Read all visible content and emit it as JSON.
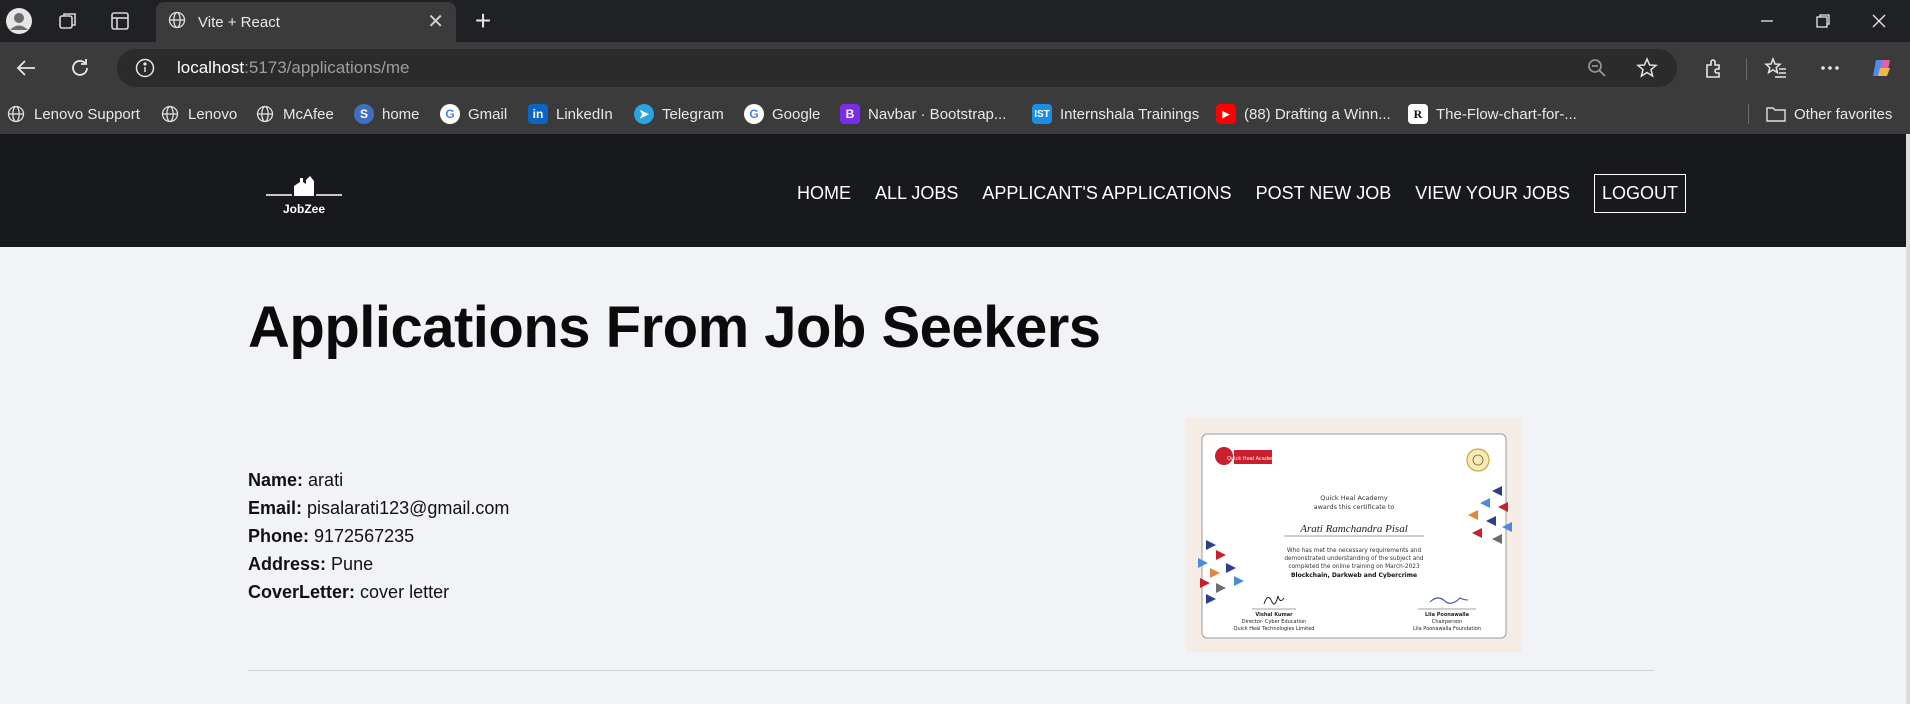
{
  "browser": {
    "tab_title": "Vite + React",
    "url_host": "localhost",
    "url_path": ":5173/applications/me",
    "bookmarks": [
      {
        "label": "Lenovo Support",
        "icon": "globe-icon"
      },
      {
        "label": "Lenovo",
        "icon": "globe-icon"
      },
      {
        "label": "McAfee",
        "icon": "globe-icon"
      },
      {
        "label": "home",
        "icon": "s-logo-icon"
      },
      {
        "label": "Gmail",
        "icon": "google-icon"
      },
      {
        "label": "LinkedIn",
        "icon": "linkedin-icon"
      },
      {
        "label": "Telegram",
        "icon": "telegram-icon"
      },
      {
        "label": "Google",
        "icon": "google-icon"
      },
      {
        "label": "Navbar · Bootstrap...",
        "icon": "bootstrap-icon"
      },
      {
        "label": "Internshala Trainings",
        "icon": "internshala-icon"
      },
      {
        "label": "(88) Drafting a Winn...",
        "icon": "youtube-icon"
      },
      {
        "label": "The-Flow-chart-for-...",
        "icon": "r-logo-icon"
      }
    ],
    "other_favorites": "Other favorites"
  },
  "site": {
    "logo_text": "JobZee",
    "nav": [
      "HOME",
      "ALL JOBS",
      "APPLICANT'S APPLICATIONS",
      "POST NEW JOB",
      "VIEW YOUR JOBS"
    ],
    "logout": "LOGOUT"
  },
  "main": {
    "title": "Applications From Job Seekers"
  },
  "application": {
    "name_label": "Name:",
    "name": "arati",
    "email_label": "Email:",
    "email": "pisalarati123@gmail.com",
    "phone_label": "Phone:",
    "phone": "9172567235",
    "address_label": "Address:",
    "address": "Pune",
    "cover_label": "CoverLetter:",
    "cover": "cover letter"
  },
  "certificate": {
    "org_badge": "Quick Heal Academy",
    "awards_line1": "Quick Heal Academy",
    "awards_line2": "awards this certificate to",
    "recipient": "Arati Ramchandra Pisal",
    "body_line1": "Who has met the necessary requirements and",
    "body_line2": "demonstrated understanding of the subject and",
    "body_line3": "completed the online training on March-2023",
    "course": "Blockchain, Darkweb and Cybercrime",
    "signer1_name": "Vishal Kumar",
    "signer1_title": "Director- Cyber Education",
    "signer1_org": "Quick Heal Technologies Limited",
    "signer2_name": "Lila Poonawalla",
    "signer2_title": "Chairperson",
    "signer2_org": "Lila Poonawalla Foundation"
  },
  "colors": {
    "nav_bg": "#18191c",
    "page_bg": "#f1f3f6",
    "chrome_bg": "#3b3b3b"
  }
}
